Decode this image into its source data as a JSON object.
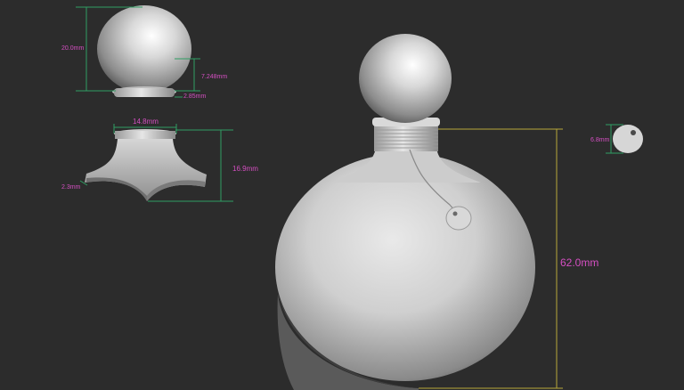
{
  "colors": {
    "background": "#2c2c2c",
    "dimension_line": "#2f9e63",
    "dimension_line_height": "#b8a83a",
    "label": "#d54fc2",
    "model_light": "#e6e6e6",
    "model_dark": "#4a4a4a"
  },
  "dimensions": {
    "sphere_height": "20.0mm",
    "stopper_neck_height": "7.248mm",
    "stopper_ring_height": "2.85mm",
    "base_top_width": "14.8mm",
    "base_height": "16.9mm",
    "base_foot_thickness": "2.3mm",
    "tag_diameter": "6.8mm",
    "bottle_height": "62.0mm"
  }
}
